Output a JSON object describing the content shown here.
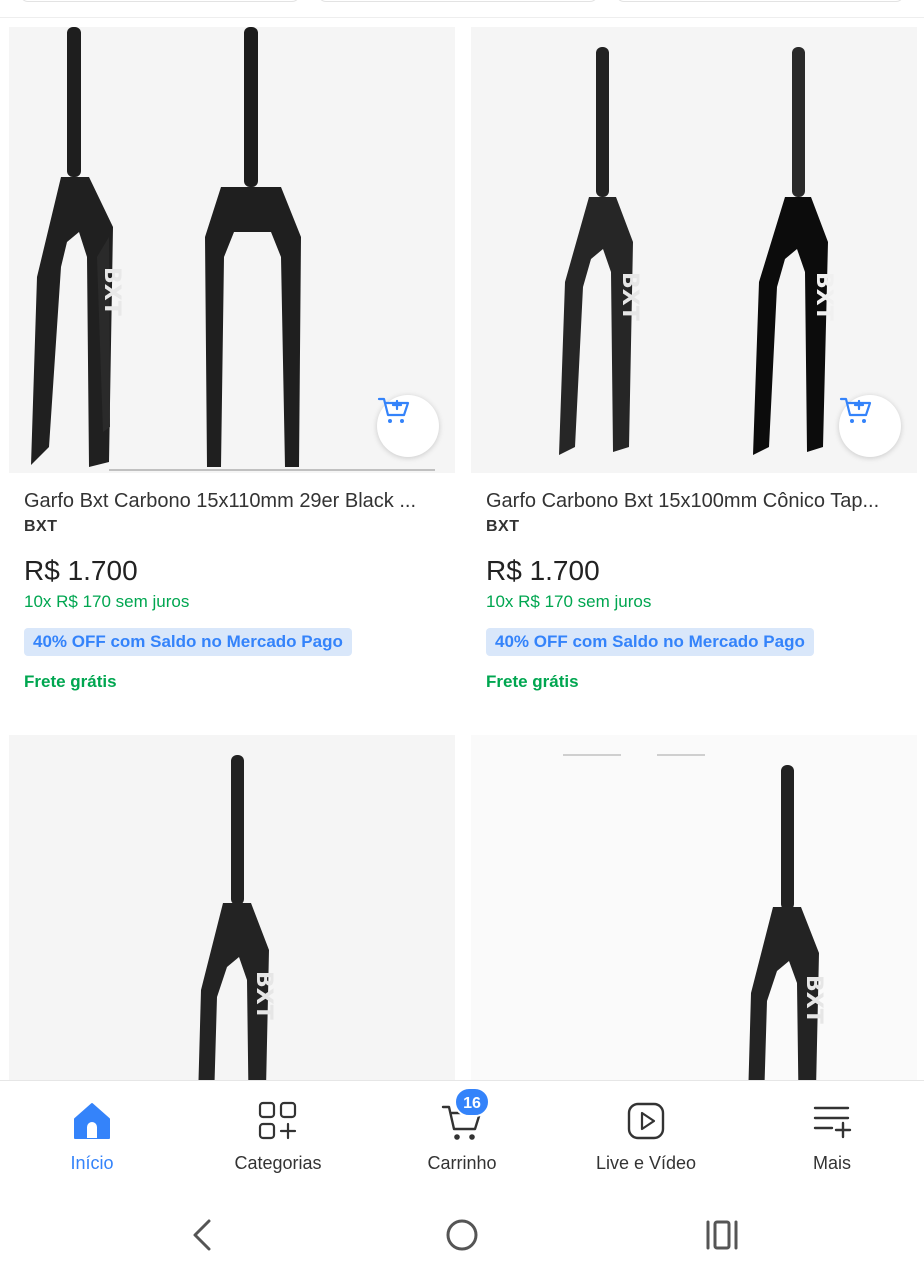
{
  "products": [
    {
      "title": "Garfo Bxt Carbono 15x110mm 29er Black ...",
      "brand": "BXT",
      "price": "R$ 1.700",
      "installments": "10x R$ 170 sem juros",
      "promo": "40% OFF com Saldo no Mercado Pago",
      "shipping": "Frete grátis",
      "image_icon": "carbon-fork-pair-matte",
      "cart_icon": "add-to-cart-icon"
    },
    {
      "title": "Garfo Carbono Bxt 15x100mm Cônico Tap...",
      "brand": "BXT",
      "price": "R$ 1.700",
      "installments": "10x R$ 170 sem juros",
      "promo": "40% OFF com Saldo no Mercado Pago",
      "shipping": "Frete grátis",
      "image_icon": "carbon-fork-pair-matte-gloss",
      "cart_icon": "add-to-cart-icon"
    },
    {
      "image_icon": "carbon-fork-single"
    },
    {
      "image_icon": "carbon-fork-single"
    }
  ],
  "bottom_nav": {
    "items": [
      {
        "label": "Início",
        "icon": "home-icon",
        "active": true
      },
      {
        "label": "Categorias",
        "icon": "categories-icon",
        "active": false
      },
      {
        "label": "Carrinho",
        "icon": "cart-icon",
        "active": false,
        "badge": "16"
      },
      {
        "label": "Live e Vídeo",
        "icon": "play-icon",
        "active": false
      },
      {
        "label": "Mais",
        "icon": "menu-plus-icon",
        "active": false
      }
    ]
  },
  "system_nav": {
    "back": "back-icon",
    "home": "home-circle-icon",
    "recents": "recents-icon"
  },
  "colors": {
    "accent": "#3483fa",
    "green": "#00a650",
    "promo_bg": "#d9e7fa"
  }
}
